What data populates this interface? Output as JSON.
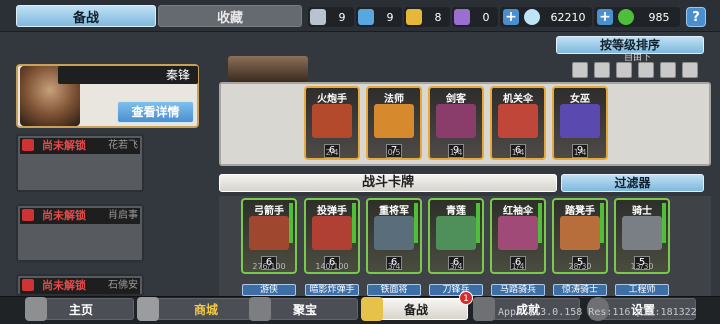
{
  "tabs": {
    "active": "备战",
    "inactive": "收藏"
  },
  "resources": [
    {
      "name": "silver-medal-icon",
      "value": "9",
      "color": "#b8c3cf"
    },
    {
      "name": "blue-medal-icon",
      "value": "9",
      "color": "#5aa7e0"
    },
    {
      "name": "gold-medal-icon",
      "value": "8",
      "color": "#e6b83a"
    },
    {
      "name": "purple-medal-icon",
      "value": "0",
      "color": "#9a6fd0"
    }
  ],
  "diamond": {
    "value": "62210"
  },
  "coins": {
    "value": "985"
  },
  "help": {
    "label": "?"
  },
  "sort_label": "按等级排序",
  "sort_hint": "自由下",
  "character": {
    "name": "秦锋",
    "detail_label": "查看详情"
  },
  "locked_chars": [
    {
      "status": "尚未解锁",
      "name": "花若飞"
    },
    {
      "status": "尚未解锁",
      "name": "肖启事"
    },
    {
      "status": "尚未解锁",
      "name": "石佛安"
    }
  ],
  "team_units": [
    {
      "label": "火炮手",
      "level": "6",
      "count": "2/4",
      "color": "#b44a2c"
    },
    {
      "label": "法师",
      "level": "7",
      "count": "0/5",
      "color": "#d78a2d"
    },
    {
      "label": "剑客",
      "level": "9",
      "count": "1/4",
      "color": "#8a3d6a"
    },
    {
      "label": "机关伞",
      "level": "6",
      "count": "1/4",
      "color": "#c0463a"
    },
    {
      "label": "女巫",
      "level": "9",
      "count": "1/4",
      "color": "#5a4ab0"
    }
  ],
  "battle_header": "战斗卡牌",
  "filter_label": "过滤器",
  "battle_units": [
    {
      "label": "弓箭手",
      "level": "6",
      "count": "276/100",
      "color": "#a0482f",
      "sub": "游侠"
    },
    {
      "label": "投弹手",
      "level": "6",
      "count": "140/100",
      "color": "#b04033",
      "sub": "暗影炸弹手"
    },
    {
      "label": "重将军",
      "level": "6",
      "count": "3/4",
      "color": "#5a6d7a",
      "sub": "铁面将"
    },
    {
      "label": "青莲",
      "level": "6",
      "count": "3/4",
      "color": "#4f8f5a",
      "sub": "刀锋兵"
    },
    {
      "label": "红袖伞",
      "level": "6",
      "count": "1/4",
      "color": "#a04a78",
      "sub": "马踏骑兵"
    },
    {
      "label": "踏凳手",
      "level": "5",
      "count": "28/30",
      "color": "#b86e3a",
      "sub": "惊涛骑士"
    },
    {
      "label": "骑士",
      "level": "5",
      "count": "13/30",
      "color": "#7a7f86",
      "sub": "工程师"
    }
  ],
  "nav": [
    {
      "label": "主页",
      "icon": "castle-icon"
    },
    {
      "label": "商城",
      "icon": "coins-icon"
    },
    {
      "label": "聚宝",
      "icon": "treasure-bowl-icon"
    },
    {
      "label": "备战",
      "icon": "cards-icon"
    },
    {
      "label": "成就",
      "icon": "trophy-icon"
    },
    {
      "label": "设置",
      "icon": "gear-icon"
    }
  ],
  "nav_badge": "1",
  "debug_text": "App: 113.0.158 Res:116 pid:181322"
}
